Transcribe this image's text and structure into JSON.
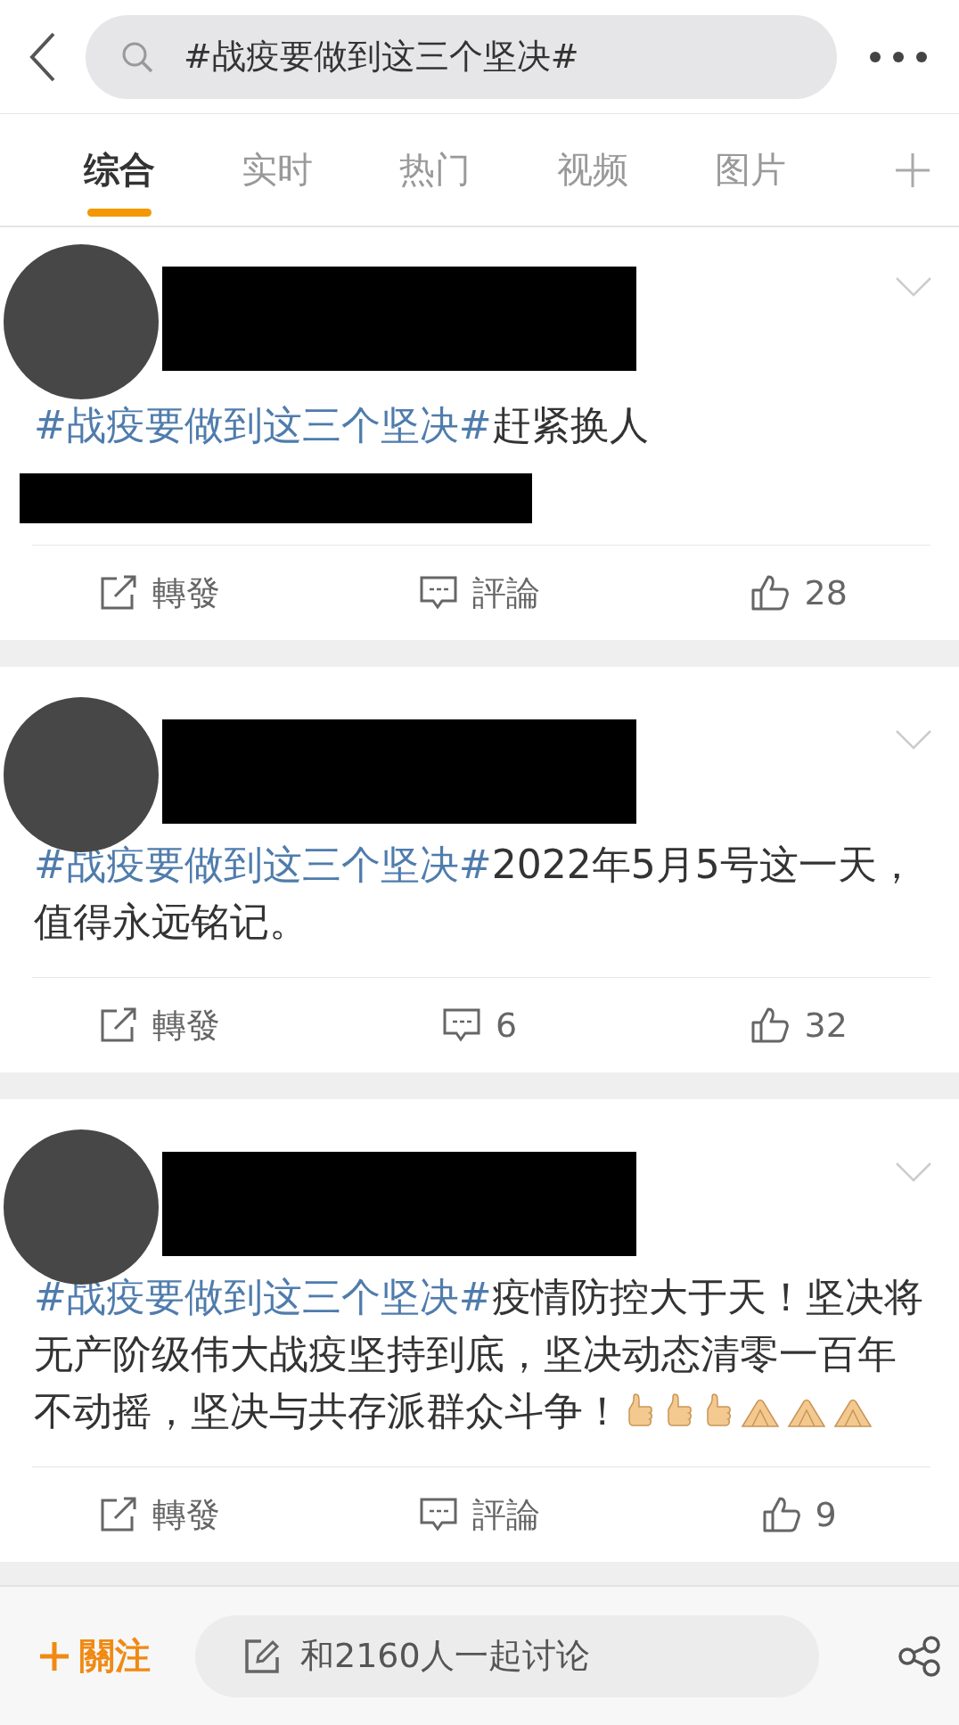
{
  "search": {
    "value": "#战疫要做到这三个坚决#"
  },
  "tabs": [
    {
      "label": "综合",
      "selected": true
    },
    {
      "label": "实时",
      "selected": false
    },
    {
      "label": "热门",
      "selected": false
    },
    {
      "label": "视频",
      "selected": false
    },
    {
      "label": "图片",
      "selected": false
    }
  ],
  "posts": [
    {
      "hashtag": "#战疫要做到这三个坚决#",
      "text": "赶紧换人",
      "extra_redacted_line": true,
      "repost": "轉發",
      "comment": "評論",
      "likes": "28"
    },
    {
      "hashtag": "#战疫要做到这三个坚决#",
      "text": "2022年5月5号这一天，值得永远铭记。",
      "extra_redacted_line": false,
      "repost": "轉發",
      "comment": "6",
      "likes": "32"
    },
    {
      "hashtag": "#战疫要做到这三个坚决#",
      "text": "疫情防控大于天！坚决将无产阶级伟大战疫坚持到底，坚决动态清零一百年不动摇，坚决与共存派群众斗争！",
      "extra_redacted_line": false,
      "emojis": [
        {
          "kind": "thumbs-up"
        },
        {
          "kind": "thumbs-up"
        },
        {
          "kind": "thumbs-up"
        },
        {
          "kind": "pressed-hands"
        },
        {
          "kind": "pressed-hands"
        },
        {
          "kind": "pressed-hands"
        }
      ],
      "repost": "轉發",
      "comment": "評論",
      "likes": "9"
    }
  ],
  "bottom_bar": {
    "follow": "關注",
    "discussion": "和2160人一起讨论"
  }
}
